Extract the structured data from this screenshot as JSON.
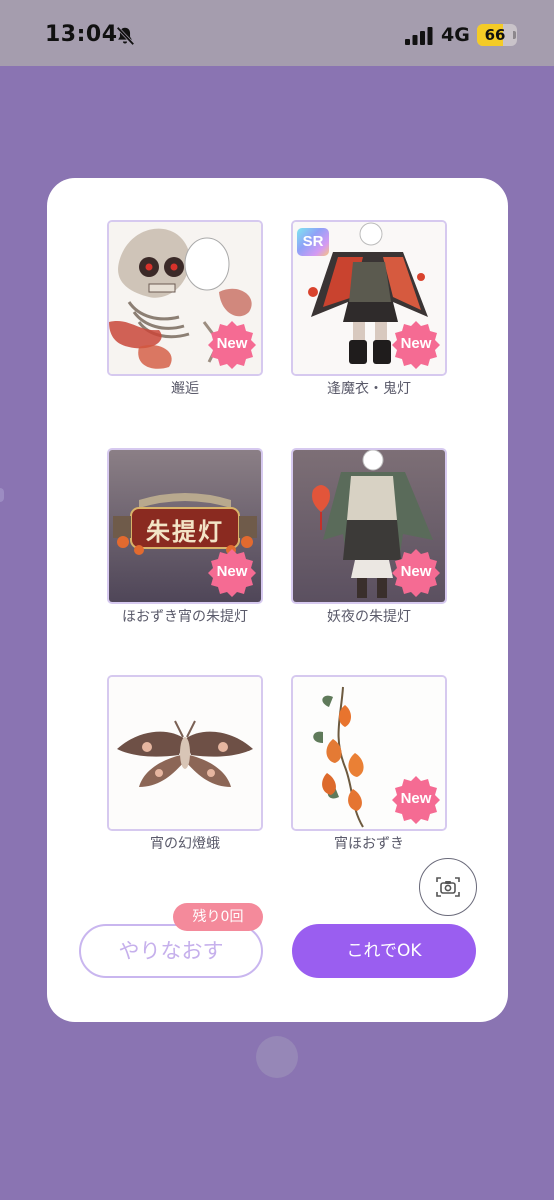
{
  "status_bar": {
    "time": "13:04",
    "network": "4G",
    "battery": "66",
    "battery_level": 0.66,
    "bell_icon": "bell-slash-icon",
    "signal_icon": "cellular-signal-icon"
  },
  "dialog": {
    "items": [
      {
        "label": "邂逅",
        "new_badge": "New"
      },
      {
        "label": "逢魔衣・鬼灯",
        "new_badge": "New",
        "rarity": "SR"
      },
      {
        "label": "ほおずき宵の朱提灯",
        "new_badge": "New",
        "sign_text": "朱提灯"
      },
      {
        "label": "妖夜の朱提灯",
        "new_badge": "New"
      },
      {
        "label": "宵の幻燈蛾"
      },
      {
        "label": "宵ほおずき",
        "new_badge": "New"
      }
    ],
    "camera_icon": "camera-capture-icon",
    "retry_button": "やりなおす",
    "remaining_badge": "残り0回",
    "ok_button": "これでOK"
  },
  "colors": {
    "background": "#8a74b2",
    "accent": "#9a5ef0",
    "badge_pink": "#f48a9b",
    "new_badge": "#f56b93"
  }
}
